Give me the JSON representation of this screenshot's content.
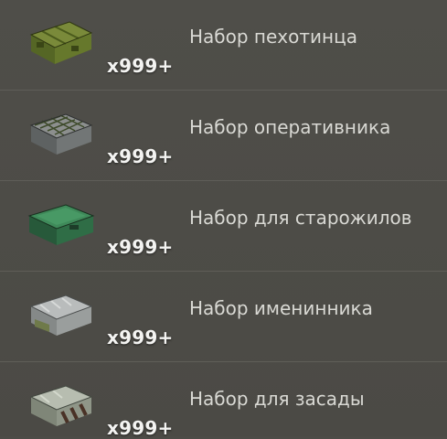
{
  "items": [
    {
      "icon": "green-military-crate-icon",
      "quantity": "x999+",
      "name": "Набор пехотинца"
    },
    {
      "icon": "gray-netted-crate-icon",
      "quantity": "x999+",
      "name": "Набор оперативника"
    },
    {
      "icon": "green-metal-crate-icon",
      "quantity": "x999+",
      "name": "Набор для старожилов"
    },
    {
      "icon": "silver-gift-crate-icon",
      "quantity": "x999+",
      "name": "Набор именинника"
    },
    {
      "icon": "camouflage-crate-icon",
      "quantity": "x999+",
      "name": "Набор для засады"
    }
  ]
}
